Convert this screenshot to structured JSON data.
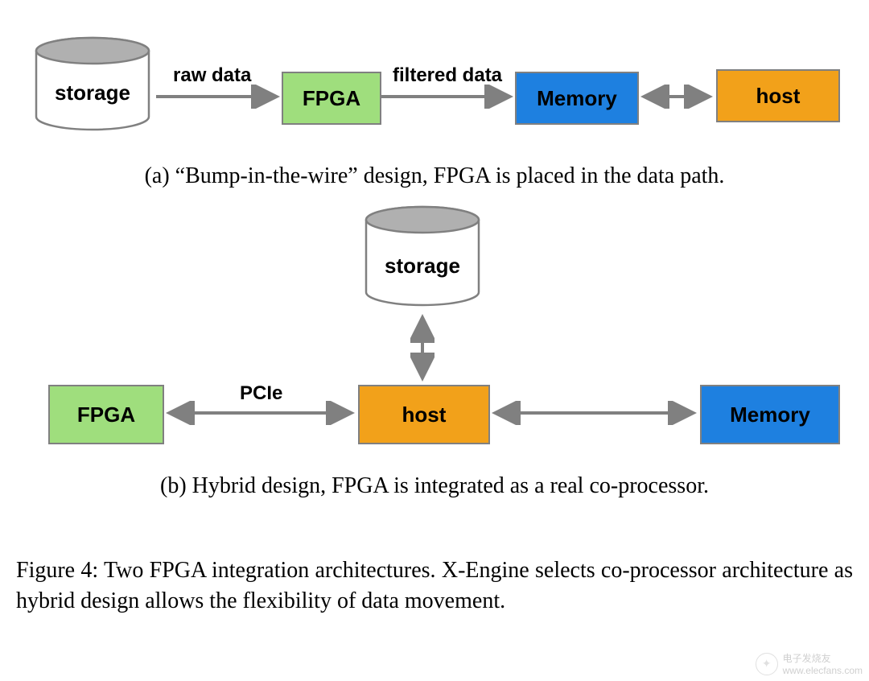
{
  "diagramA": {
    "storage": "storage",
    "fpga": "FPGA",
    "memory": "Memory",
    "host": "host",
    "arrow1_label": "raw data",
    "arrow2_label": "filtered data",
    "caption": "(a) “Bump-in-the-wire” design, FPGA is placed in the data path."
  },
  "diagramB": {
    "storage": "storage",
    "fpga": "FPGA",
    "host": "host",
    "memory": "Memory",
    "arrow1_label": "PCIe",
    "caption": "(b) Hybrid design, FPGA is integrated as a real co-processor."
  },
  "figure_caption": "Figure 4: Two FPGA integration architectures. X-Engine selects co-processor architecture as hybrid design allows the flexibility of data movement.",
  "watermark": {
    "line1": "电子发烧友",
    "line2": "www.elecfans.com"
  }
}
